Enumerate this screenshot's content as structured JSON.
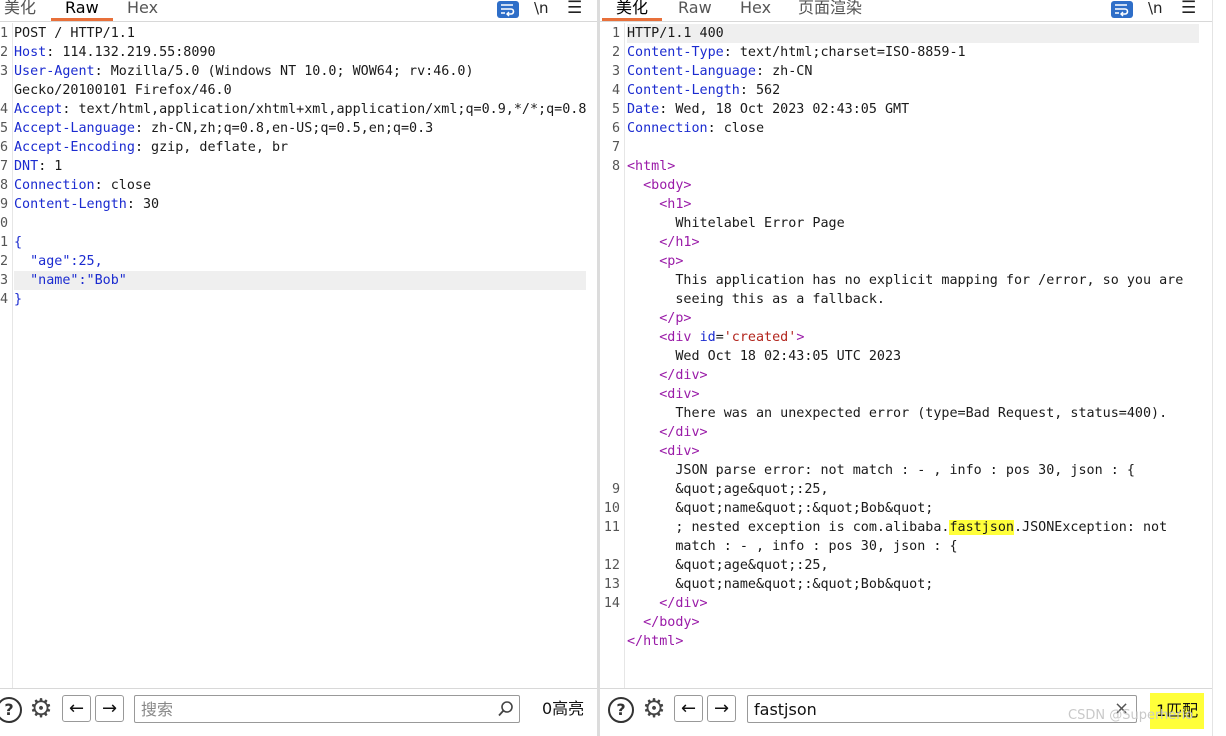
{
  "request": {
    "tabs": [
      "美化",
      "Raw",
      "Hex"
    ],
    "active_tab": "Raw",
    "newline_toggle": "\\n",
    "menu_icon": "hamburger-icon",
    "lines": [
      {
        "n": "1",
        "text": "POST / HTTP/1.1"
      },
      {
        "n": "2",
        "key": "Host",
        "val": " 114.132.219.55:8090"
      },
      {
        "n": "3",
        "key": "User-Agent",
        "val": " Mozilla/5.0 (Windows NT 10.0; WOW64; rv:46.0)"
      },
      {
        "n": "",
        "text": "Gecko/20100101 Firefox/46.0"
      },
      {
        "n": "4",
        "key": "Accept",
        "val": " text/html,application/xhtml+xml,application/xml;q=0.9,*/*;q=0.8"
      },
      {
        "n": "5",
        "key": "Accept-Language",
        "val": " zh-CN,zh;q=0.8,en-US;q=0.5,en;q=0.3"
      },
      {
        "n": "6",
        "key": "Accept-Encoding",
        "val": " gzip, deflate, br"
      },
      {
        "n": "7",
        "key": "DNT",
        "val": " 1"
      },
      {
        "n": "8",
        "key": "Connection",
        "val": " close"
      },
      {
        "n": "9",
        "key": "Content-Length",
        "val": " 30"
      },
      {
        "n": "0",
        "text": ""
      },
      {
        "n": "1",
        "json": "{"
      },
      {
        "n": "2",
        "json": "  \"age\":25,"
      },
      {
        "n": "3",
        "json": "  \"name\":\"Bob\""
      },
      {
        "n": "4",
        "json": "}"
      }
    ],
    "search": {
      "placeholder": "搜索",
      "value": "",
      "count": "0高亮"
    }
  },
  "response": {
    "tabs": [
      "美化",
      "Raw",
      "Hex",
      "页面渲染"
    ],
    "active_tab": "美化",
    "newline_toggle": "\\n",
    "menu_icon": "hamburger-icon",
    "lines": [
      {
        "n": "1",
        "text": "HTTP/1.1 400"
      },
      {
        "n": "2",
        "key": "Content-Type",
        "val": " text/html;charset=ISO-8859-1"
      },
      {
        "n": "3",
        "key": "Content-Language",
        "val": " zh-CN"
      },
      {
        "n": "4",
        "key": "Content-Length",
        "val": " 562"
      },
      {
        "n": "5",
        "key": "Date",
        "val": " Wed, 18 Oct 2023 02:43:05 GMT"
      },
      {
        "n": "6",
        "key": "Connection",
        "val": " close"
      },
      {
        "n": "7",
        "text": ""
      },
      {
        "n": "8",
        "html": [
          [
            "tag",
            "<html>"
          ]
        ]
      },
      {
        "n": "",
        "html": [
          [
            "",
            "  "
          ],
          [
            "tag",
            "<body>"
          ]
        ]
      },
      {
        "n": "",
        "html": [
          [
            "",
            "    "
          ],
          [
            "tag",
            "<h1>"
          ]
        ]
      },
      {
        "n": "",
        "text": "      Whitelabel Error Page"
      },
      {
        "n": "",
        "html": [
          [
            "",
            "    "
          ],
          [
            "tag",
            "</h1>"
          ]
        ]
      },
      {
        "n": "",
        "html": [
          [
            "",
            "    "
          ],
          [
            "tag",
            "<p>"
          ]
        ]
      },
      {
        "n": "",
        "text": "      This application has no explicit mapping for /error, so you are"
      },
      {
        "n": "",
        "text": "      seeing this as a fallback."
      },
      {
        "n": "",
        "html": [
          [
            "",
            "    "
          ],
          [
            "tag",
            "</p>"
          ]
        ]
      },
      {
        "n": "",
        "html": [
          [
            "",
            "    "
          ],
          [
            "tag",
            "<div "
          ],
          [
            "attr",
            "id"
          ],
          [
            "",
            "="
          ],
          [
            "str",
            "'created'"
          ],
          [
            "tag",
            ">"
          ]
        ]
      },
      {
        "n": "",
        "text": "      Wed Oct 18 02:43:05 UTC 2023"
      },
      {
        "n": "",
        "html": [
          [
            "",
            "    "
          ],
          [
            "tag",
            "</div>"
          ]
        ]
      },
      {
        "n": "",
        "html": [
          [
            "",
            "    "
          ],
          [
            "tag",
            "<div>"
          ]
        ]
      },
      {
        "n": "",
        "text": "      There was an unexpected error (type=Bad Request, status=400)."
      },
      {
        "n": "",
        "html": [
          [
            "",
            "    "
          ],
          [
            "tag",
            "</div>"
          ]
        ]
      },
      {
        "n": "",
        "html": [
          [
            "",
            "    "
          ],
          [
            "tag",
            "<div>"
          ]
        ]
      },
      {
        "n": "",
        "text": "      JSON parse error: not match : - , info : pos 30, json : {"
      },
      {
        "n": "9",
        "text": "      &quot;age&quot;:25,"
      },
      {
        "n": "10",
        "text": "      &quot;name&quot;:&quot;Bob&quot;"
      },
      {
        "n": "11",
        "html": [
          [
            "",
            "      ; nested exception is com.alibaba."
          ],
          [
            "mark",
            "fastjson"
          ],
          [
            "",
            ".JSONException: not"
          ]
        ]
      },
      {
        "n": "",
        "text": "      match : - , info : pos 30, json : {"
      },
      {
        "n": "12",
        "text": "      &quot;age&quot;:25,"
      },
      {
        "n": "13",
        "text": "      &quot;name&quot;:&quot;Bob&quot;"
      },
      {
        "n": "14",
        "html": [
          [
            "",
            "    "
          ],
          [
            "tag",
            "</div>"
          ]
        ]
      },
      {
        "n": "",
        "html": [
          [
            "",
            "  "
          ],
          [
            "tag",
            "</body>"
          ]
        ]
      },
      {
        "n": "",
        "html": [
          [
            "tag",
            "</html>"
          ]
        ]
      }
    ],
    "search": {
      "placeholder": "",
      "value": "fastjson",
      "count": "1匹配"
    }
  },
  "watermark": "CSDN @Superherio",
  "colors": {
    "accent": "#e8703a",
    "key": "#1b2bd0",
    "tag": "#9a1ba8",
    "string": "#b3261e",
    "highlight": "#ffff3a"
  }
}
